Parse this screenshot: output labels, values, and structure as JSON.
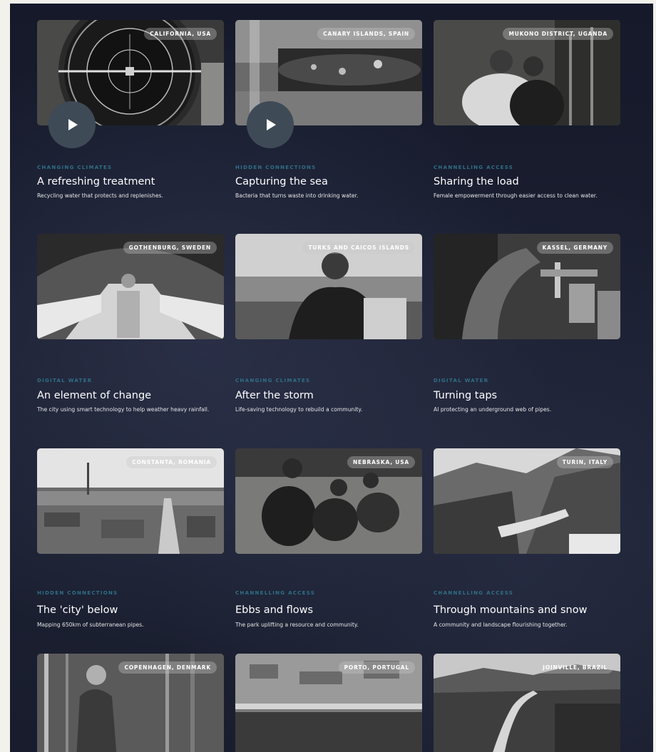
{
  "cards": [
    {
      "location": "CALIFORNIA, USA",
      "category": "CHANGING CLIMATES",
      "title": "A refreshing treatment",
      "description": "Recycling water that protects and replenishes.",
      "has_video": true
    },
    {
      "location": "CANARY ISLANDS, SPAIN",
      "category": "HIDDEN CONNECTIONS",
      "title": "Capturing the sea",
      "description": "Bacteria that turns waste into drinking water.",
      "has_video": true
    },
    {
      "location": "MUKONO DISTRICT, UGANDA",
      "category": "CHANNELLING ACCESS",
      "title": "Sharing the load",
      "description": "Female empowerment through easier access to clean water.",
      "has_video": false
    },
    {
      "location": "GOTHENBURG, SWEDEN",
      "category": "DIGITAL WATER",
      "title": "An element of change",
      "description": "The city using smart technology to help weather heavy rainfall.",
      "has_video": false
    },
    {
      "location": "TURKS AND CAICOS ISLANDS",
      "category": "CHANGING CLIMATES",
      "title": "After the storm",
      "description": "Life-saving technology to rebuild a community.",
      "has_video": false
    },
    {
      "location": "KASSEL, GERMANY",
      "category": "DIGITAL WATER",
      "title": "Turning taps",
      "description": "AI protecting an underground web of pipes.",
      "has_video": false
    },
    {
      "location": "CONSTANTA, ROMANIA",
      "category": "HIDDEN CONNECTIONS",
      "title": "The 'city' below",
      "description": "Mapping 650km of subterranean pipes.",
      "has_video": false
    },
    {
      "location": "NEBRASKA, USA",
      "category": "CHANNELLING ACCESS",
      "title": "Ebbs and flows",
      "description": "The park uplifting a resource and community.",
      "has_video": false
    },
    {
      "location": "TURIN, ITALY",
      "category": "CHANNELLING ACCESS",
      "title": "Through mountains and snow",
      "description": "A community and landscape flourishing together.",
      "has_video": false
    },
    {
      "location": "COPENHAGEN, DENMARK",
      "category": "",
      "title": "",
      "description": "",
      "has_video": false
    },
    {
      "location": "PORTO, PORTUGAL",
      "category": "",
      "title": "",
      "description": "",
      "has_video": false
    },
    {
      "location": "JOINVILLE, BRAZIL",
      "category": "",
      "title": "",
      "description": "",
      "has_video": false
    }
  ],
  "icons": {
    "play": "play-icon"
  },
  "colors": {
    "background": "#1a1e30",
    "tag": "#2f6f86",
    "title": "#ffffff",
    "badge": "rgba(200,200,200,0.35)"
  }
}
